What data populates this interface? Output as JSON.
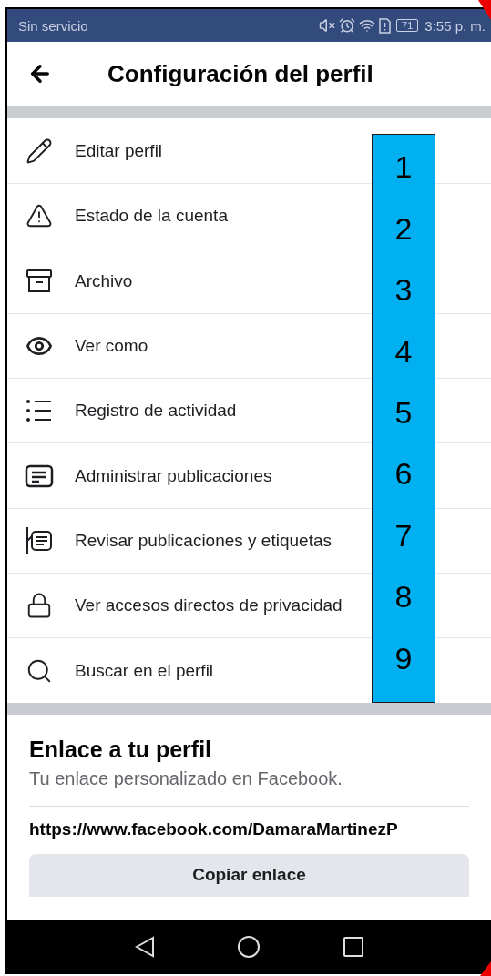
{
  "status_bar": {
    "carrier": "Sin servicio",
    "battery": "71",
    "time": "3:55 p. m."
  },
  "header": {
    "title": "Configuración del perfil"
  },
  "menu_items": [
    {
      "label": "Editar perfil"
    },
    {
      "label": "Estado de la cuenta"
    },
    {
      "label": "Archivo"
    },
    {
      "label": "Ver como"
    },
    {
      "label": "Registro de actividad"
    },
    {
      "label": "Administrar publicaciones"
    },
    {
      "label": "Revisar publicaciones y etiquetas"
    },
    {
      "label": "Ver accesos directos de privacidad"
    },
    {
      "label": "Buscar en el perfil"
    }
  ],
  "annotation": {
    "numbers": [
      "1",
      "2",
      "3",
      "4",
      "5",
      "6",
      "7",
      "8",
      "9"
    ]
  },
  "profile_link": {
    "title": "Enlace a tu perfil",
    "subtitle": "Tu enlace personalizado en Facebook.",
    "url": "https://www.facebook.com/DamaraMartinezP",
    "button": "Copiar enlace"
  }
}
